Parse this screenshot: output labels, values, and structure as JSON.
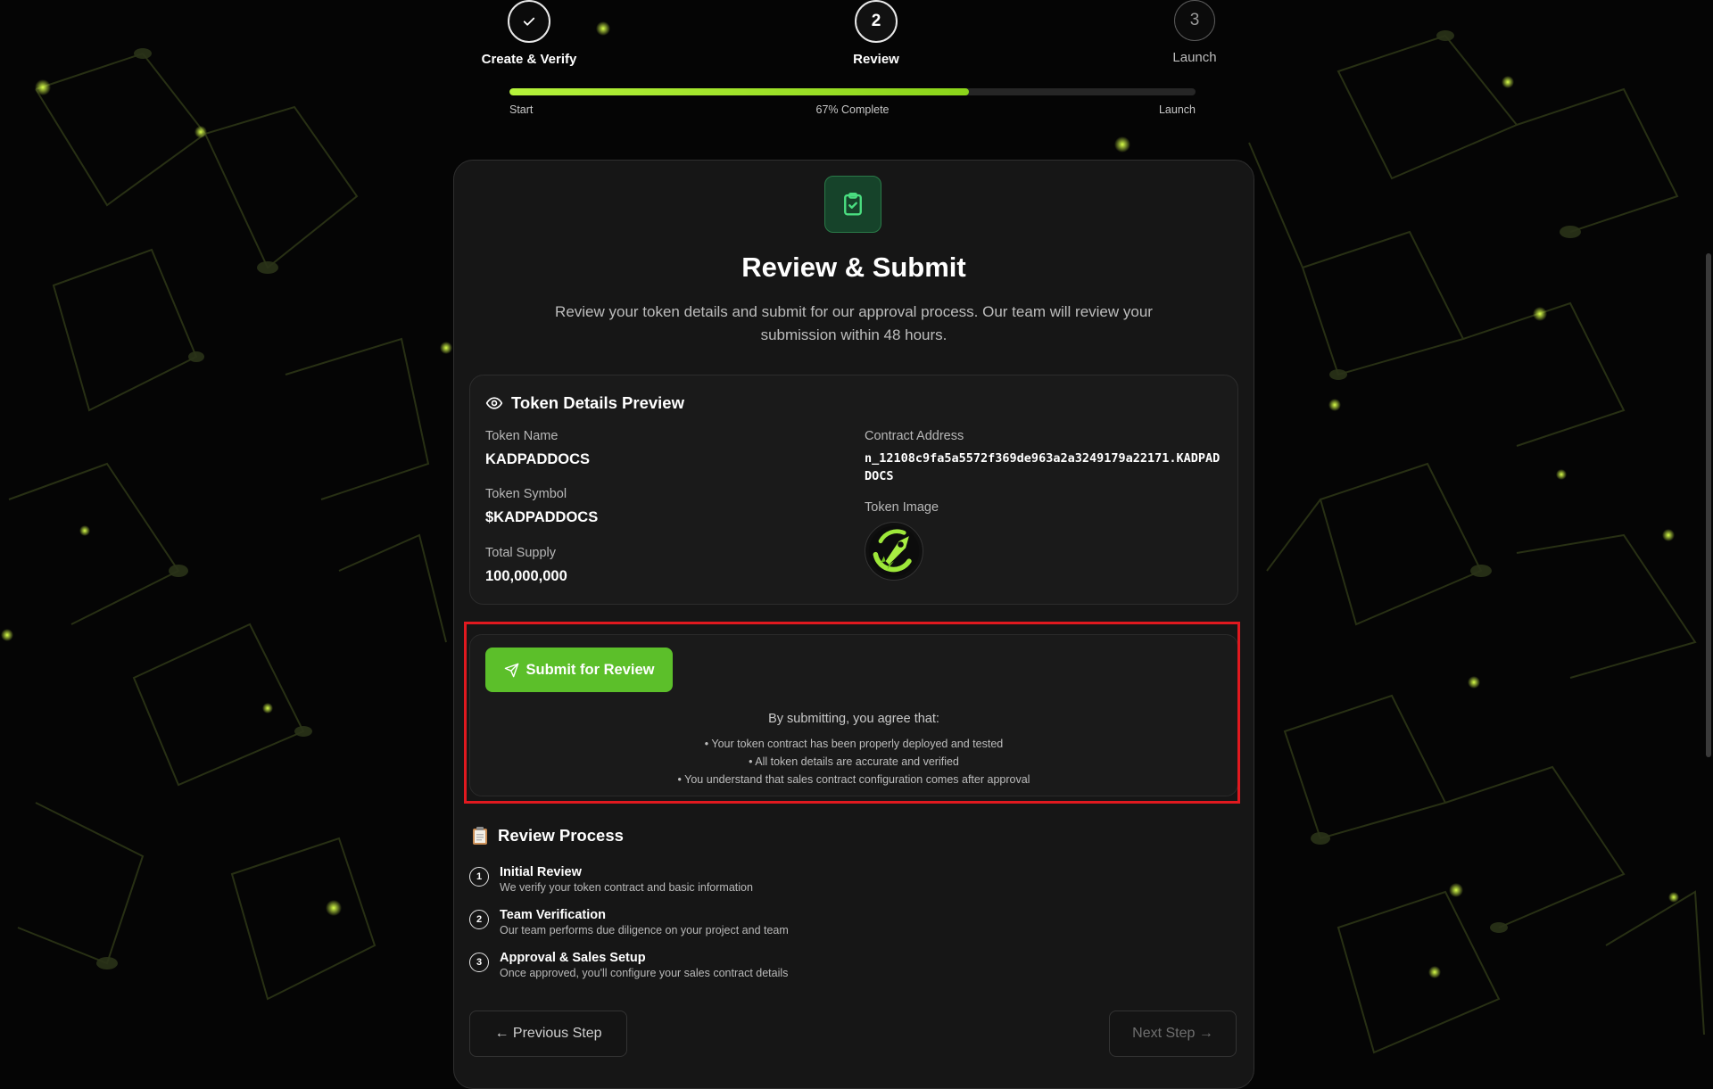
{
  "stepper": {
    "steps": [
      {
        "number": "",
        "label": "Create & Verify",
        "state": "done"
      },
      {
        "number": "2",
        "label": "Review",
        "state": "active"
      },
      {
        "number": "3",
        "label": "Launch",
        "state": "upcoming"
      }
    ],
    "progress": {
      "percent": 67,
      "start_label": "Start",
      "mid_label": "67% Complete",
      "end_label": "Launch"
    }
  },
  "card": {
    "icon": "clipboard-check-icon",
    "title": "Review & Submit",
    "subtitle": "Review your token details and submit for our approval process. Our team will review your submission within 48 hours."
  },
  "preview": {
    "icon": "eye-icon",
    "title": "Token Details Preview",
    "token_name_label": "Token Name",
    "token_name": "KADPADDOCS",
    "token_symbol_label": "Token Symbol",
    "token_symbol": "$KADPADDOCS",
    "total_supply_label": "Total Supply",
    "total_supply": "100,000,000",
    "contract_label": "Contract Address",
    "contract_address": "n_12108c9fa5a5572f369de963a2a3249179a22171.KADPADDOCS",
    "image_label": "Token Image",
    "image_icon": "rocket-logo"
  },
  "submit": {
    "button_icon": "send-icon",
    "button_label": "Submit for Review",
    "agree_heading": "By submitting, you agree that:",
    "terms": [
      "• Your token contract has been properly deployed and tested",
      "• All token details are accurate and verified",
      "• You understand that sales contract configuration comes after approval"
    ]
  },
  "review_process": {
    "icon": "clipboard-emoji-icon",
    "title": "Review Process",
    "items": [
      {
        "number": "1",
        "title": "Initial Review",
        "desc": "We verify your token contract and basic information"
      },
      {
        "number": "2",
        "title": "Team Verification",
        "desc": "Our team performs due diligence on your project and team"
      },
      {
        "number": "3",
        "title": "Approval & Sales Setup",
        "desc": "Once approved, you'll configure your sales contract details"
      }
    ]
  },
  "nav": {
    "prev_label": "← Previous Step",
    "next_label": "Next Step →"
  },
  "colors": {
    "accent": "#5cbf2a",
    "progress": "#b5f23a",
    "highlight": "#e0191f",
    "background": "#050505"
  }
}
